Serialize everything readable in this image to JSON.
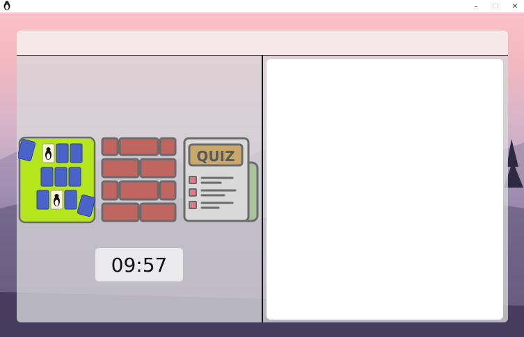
{
  "window": {
    "app_icon": "penguin-icon",
    "minimize_glyph": "–",
    "maximize_glyph": "☐",
    "close_glyph": "✕"
  },
  "games": [
    {
      "name": "memory-cards",
      "icon": "memory-game-icon",
      "selected": true,
      "accent": "#b5e61d"
    },
    {
      "name": "brick-wall",
      "icon": "brick-wall-icon",
      "selected": false,
      "accent": "#c0655f"
    },
    {
      "name": "quiz",
      "icon": "quiz-icon",
      "selected": false,
      "label": "QUIZ",
      "accent": "#c9a86b"
    }
  ],
  "timer": {
    "value": "09:57"
  },
  "colors": {
    "selected_tile": "#b5e61d",
    "brick": "#c0655f",
    "quiz_paper": "#d9d9d9",
    "quiz_badge": "#c9a86b"
  }
}
